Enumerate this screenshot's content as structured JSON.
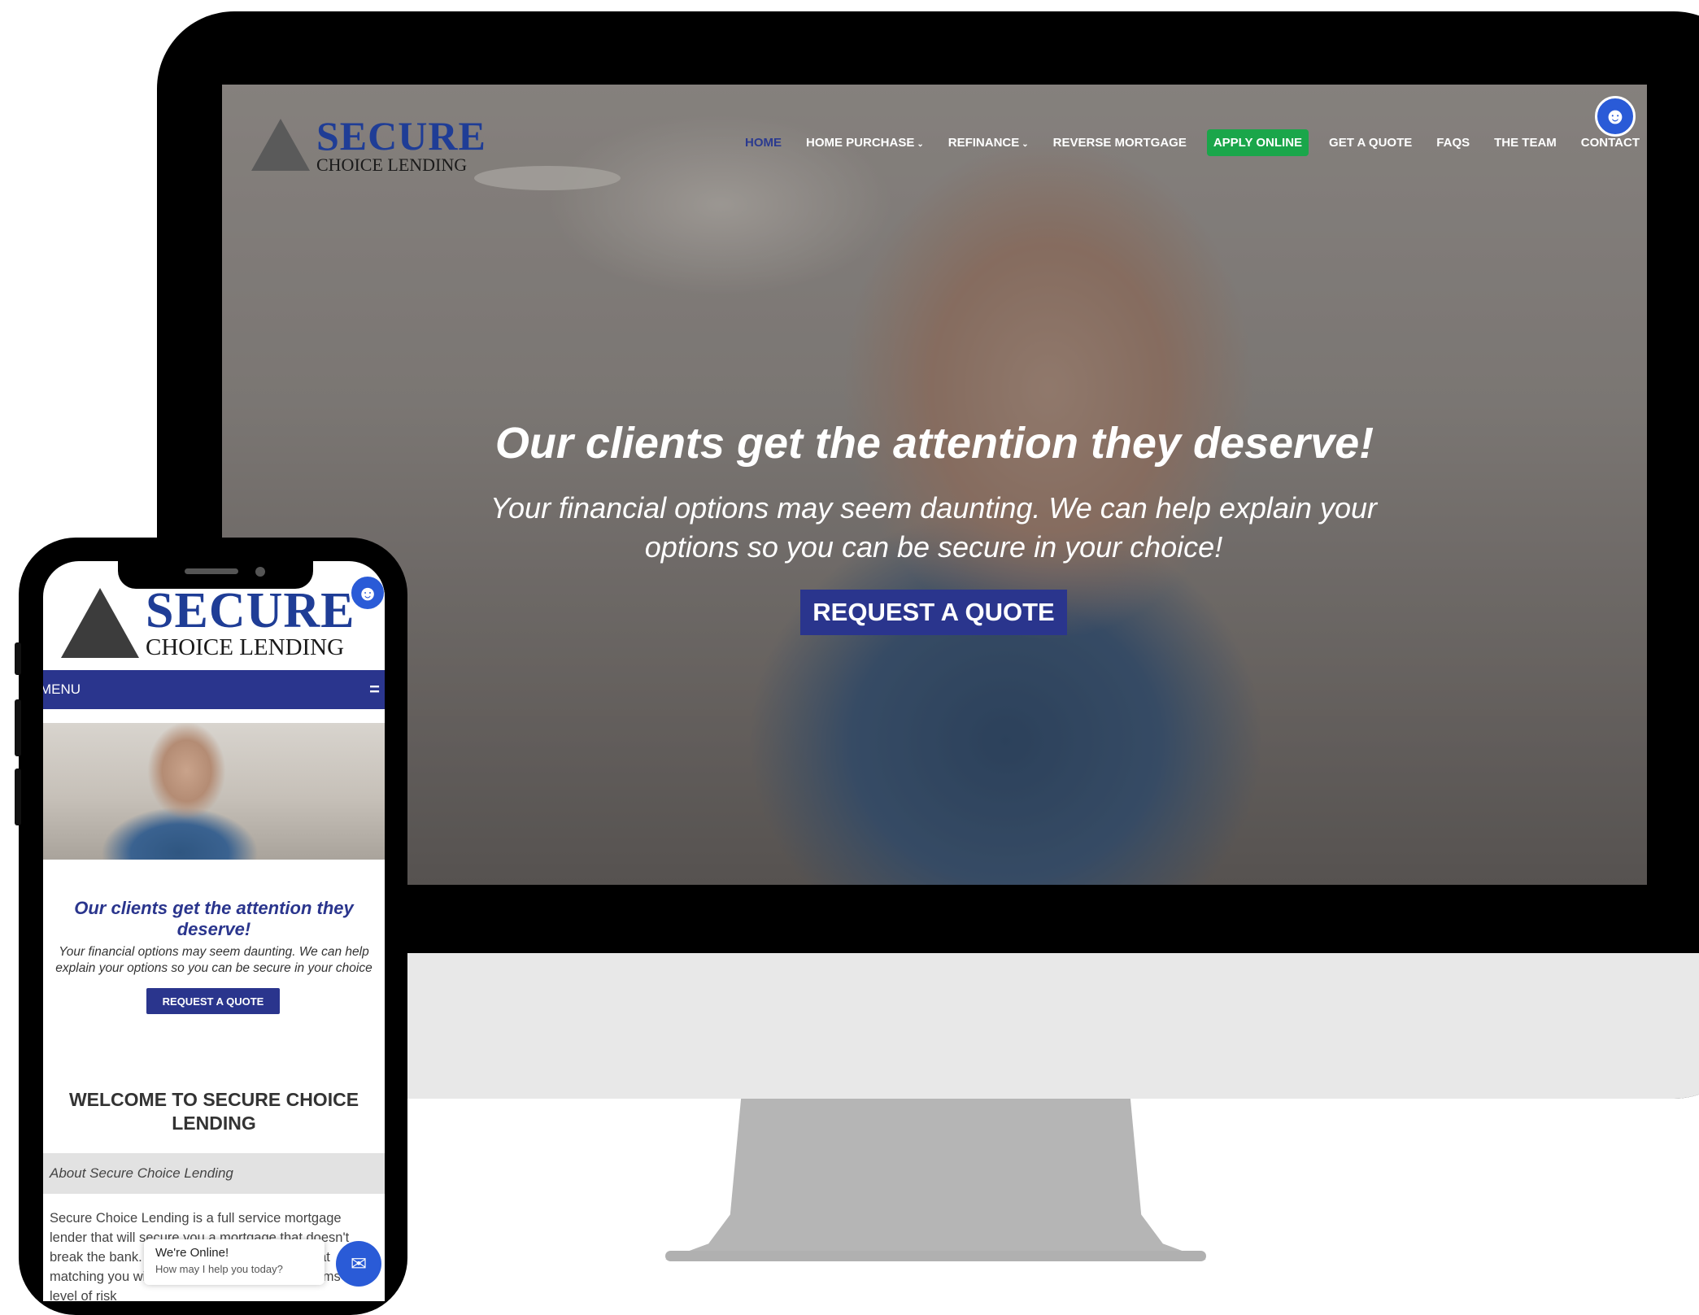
{
  "brand": {
    "secure": "SECURE",
    "choice_lending": "CHOICE LENDING"
  },
  "desktop": {
    "nav": {
      "home": "HOME",
      "home_purchase": "HOME PURCHASE",
      "refinance": "REFINANCE",
      "reverse_mortgage": "REVERSE MORTGAGE",
      "apply_online": "APPLY ONLINE",
      "get_a_quote": "GET A QUOTE",
      "faqs": "FAQS",
      "the_team": "THE TEAM",
      "contact": "CONTACT",
      "chevron": "⌄"
    },
    "hero": {
      "title": "Our clients get the attention they deserve!",
      "subtitle": "Your financial options may seem daunting. We can help explain your options so you can be secure in your choice!",
      "button": "REQUEST A QUOTE"
    },
    "accessibility_icon": "accessibility-icon"
  },
  "mobile": {
    "menu_label": "MENU",
    "menu_icon": "=",
    "hero": {
      "title": "Our clients get the attention they deserve!",
      "subtitle": "Your financial options may seem daunting. We can help explain your options so you can be secure in your choice",
      "button": "REQUEST A QUOTE"
    },
    "welcome": "WELCOME TO SECURE CHOICE LENDING",
    "about": "About Secure Choice Lending",
    "body": "Secure Choice Lending is a full service mortgage lender that will secure you a mortgage that doesn't break the bank. Our team of experts is adept at matching you with the appropriate loan programs and level of risk",
    "chat": {
      "title": "We're Online!",
      "subtitle": "How may I help you today?"
    }
  },
  "colors": {
    "brand_blue": "#2a358d",
    "apply_green": "#1aa64a",
    "a11y_blue": "#2a5bd7"
  }
}
